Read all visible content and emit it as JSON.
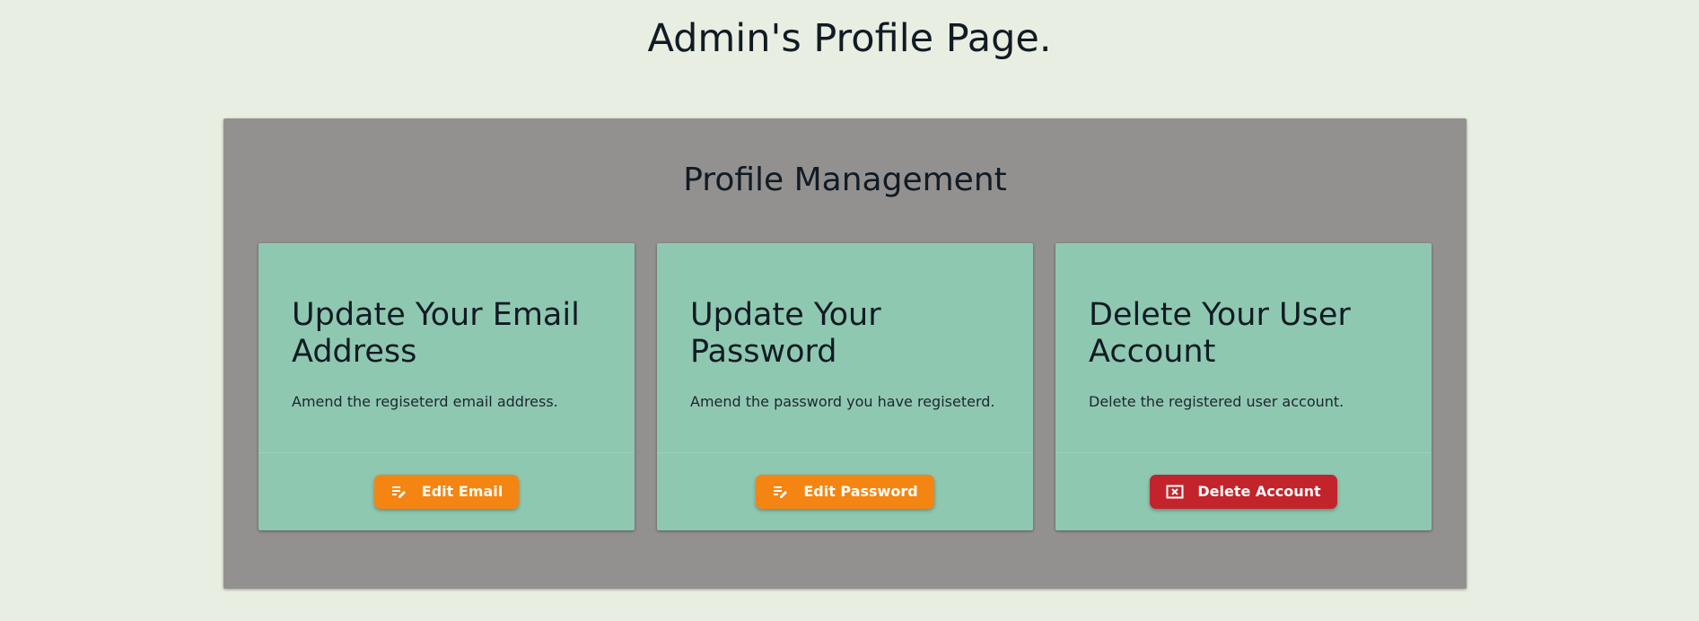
{
  "page": {
    "title": "Admin's Profile Page."
  },
  "panel": {
    "title": "Profile Management",
    "cards": [
      {
        "title": "Update Your Email Address",
        "text": "Amend the regiseterd email address.",
        "button_label": "Edit Email",
        "button_icon": "edit-note-icon",
        "button_color": "#f58512"
      },
      {
        "title": "Update Your Password",
        "text": "Amend the password you have regiseterd.",
        "button_label": "Edit Password",
        "button_icon": "edit-note-icon",
        "button_color": "#f58512"
      },
      {
        "title": "Delete Your User Account",
        "text": "Delete the registered user account.",
        "button_label": "Delete Account",
        "button_icon": "cancel-presentation-icon",
        "button_color": "#c3242b"
      }
    ]
  },
  "colors": {
    "background": "#e8eee1",
    "panel": "#939190",
    "card": "#8fc8b1"
  }
}
